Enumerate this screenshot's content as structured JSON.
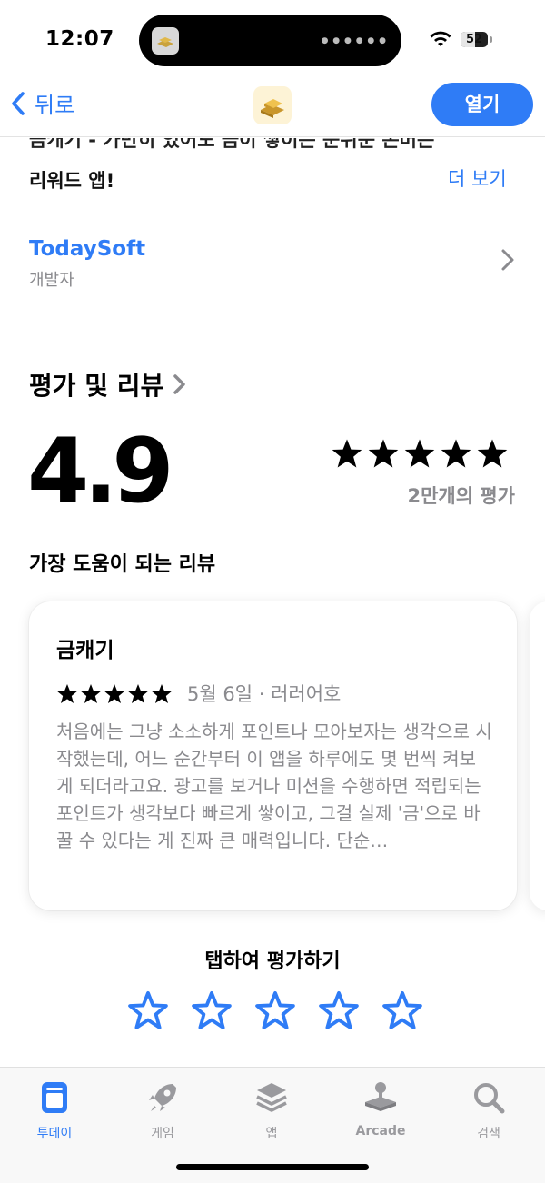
{
  "status_bar": {
    "time": "12:07",
    "battery": "52"
  },
  "nav": {
    "back_label": "뒤로",
    "open_label": "열기"
  },
  "description": {
    "line1": "금캐기 - 가만히 있어도 금이 쌓이는 눈뒤운 돈버는",
    "line2": "리워드 앱!",
    "more_label": "더 보기"
  },
  "developer": {
    "name": "TodaySoft",
    "role": "개발자"
  },
  "ratings": {
    "section_title": "평가 및 리뷰",
    "score": "4.9",
    "stars": 5,
    "count_label": "2만개의 평가",
    "helpful_title": "가장 도움이 되는 리뷰"
  },
  "review": {
    "title": "금캐기",
    "stars": 5,
    "meta": "5월 6일 · 러러어호",
    "body": "처음에는 그냥 소소하게 포인트나 모아보자는 생각으로 시작했는데, 어느 순간부터 이 앱을 하루에도 몇 번씩 켜보게 되더라고요. 광고를 보거나 미션을 수행하면 적립되는 포인트가 생각보다 빠르게 쌓이고, 그걸 실제 '금'으로 바꿀 수 있다는 게 진짜 큰 매력입니다. 단순…"
  },
  "tap_to_rate": {
    "title": "탭하여 평가하기"
  },
  "tabbar": {
    "items": [
      {
        "label": "투데이",
        "icon": "today-icon",
        "active": true
      },
      {
        "label": "게임",
        "icon": "rocket-icon",
        "active": false
      },
      {
        "label": "앱",
        "icon": "layers-icon",
        "active": false
      },
      {
        "label": "Arcade",
        "icon": "joystick-icon",
        "active": false
      },
      {
        "label": "검색",
        "icon": "search-icon",
        "active": false
      }
    ]
  },
  "colors": {
    "accent": "#2f7cf6",
    "secondary_text": "#8a8a8e"
  }
}
